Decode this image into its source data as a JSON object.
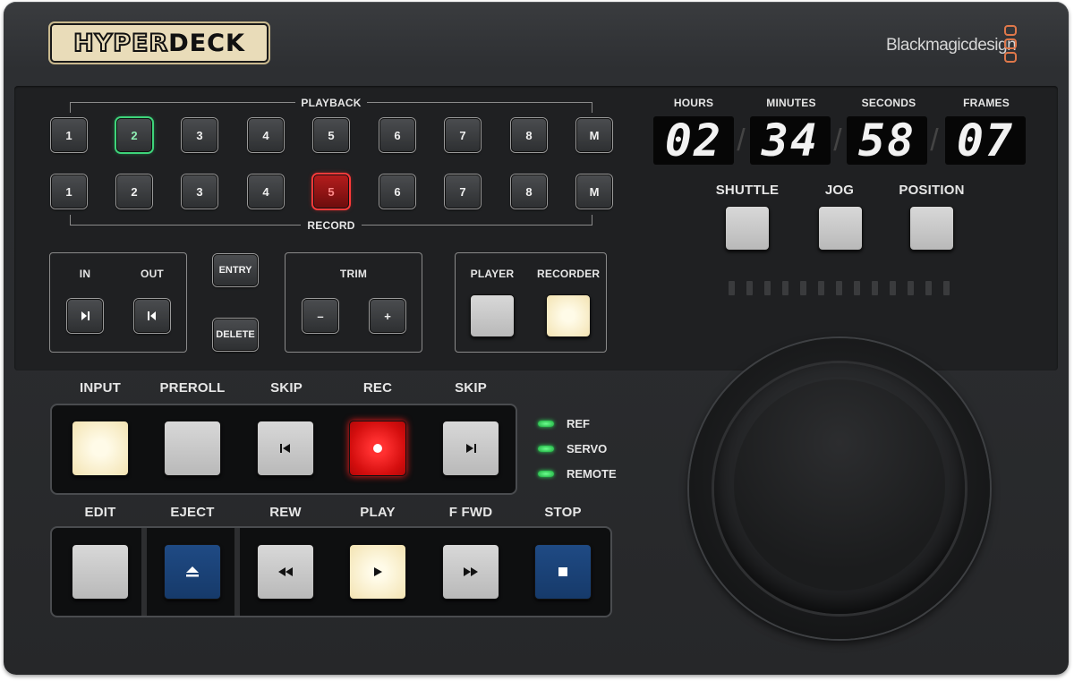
{
  "branding": {
    "logo_part1": "HYPER",
    "logo_part2": "DECK",
    "maker": "Blackmagicdesign"
  },
  "selector": {
    "playback_label": "PLAYBACK",
    "record_label": "RECORD",
    "playback_keys": [
      "1",
      "2",
      "3",
      "4",
      "5",
      "6",
      "7",
      "8",
      "M"
    ],
    "record_keys": [
      "1",
      "2",
      "3",
      "4",
      "5",
      "6",
      "7",
      "8",
      "M"
    ],
    "playback_active": "2",
    "record_active": "5"
  },
  "inout": {
    "in_label": "IN",
    "out_label": "OUT",
    "entry_label": "ENTRY",
    "delete_label": "DELETE"
  },
  "trim": {
    "label": "TRIM",
    "minus": "–",
    "plus": "+"
  },
  "mode": {
    "player_label": "PLAYER",
    "recorder_label": "RECORDER"
  },
  "timecode": {
    "hours_label": "HOURS",
    "minutes_label": "MINUTES",
    "seconds_label": "SECONDS",
    "frames_label": "FRAMES",
    "hours": "02",
    "minutes": "34",
    "seconds": "58",
    "frames": "07"
  },
  "wheel_mode": {
    "shuttle": "SHUTTLE",
    "jog": "JOG",
    "position": "POSITION"
  },
  "transport_top": {
    "input": "INPUT",
    "preroll": "PREROLL",
    "skip_back": "SKIP",
    "rec": "REC",
    "skip_fwd": "SKIP"
  },
  "transport_bottom": {
    "edit": "EDIT",
    "eject": "EJECT",
    "rew": "REW",
    "play": "PLAY",
    "ffwd": "F FWD",
    "stop": "STOP"
  },
  "status": {
    "ref": "REF",
    "servo": "SERVO",
    "remote": "REMOTE"
  },
  "colors": {
    "green_active": "#3ed47a",
    "red_active": "#ff3a3a",
    "cream_lit": "#f3e3b2",
    "blue_key": "#1f4a84",
    "led_green": "#2be05a"
  }
}
